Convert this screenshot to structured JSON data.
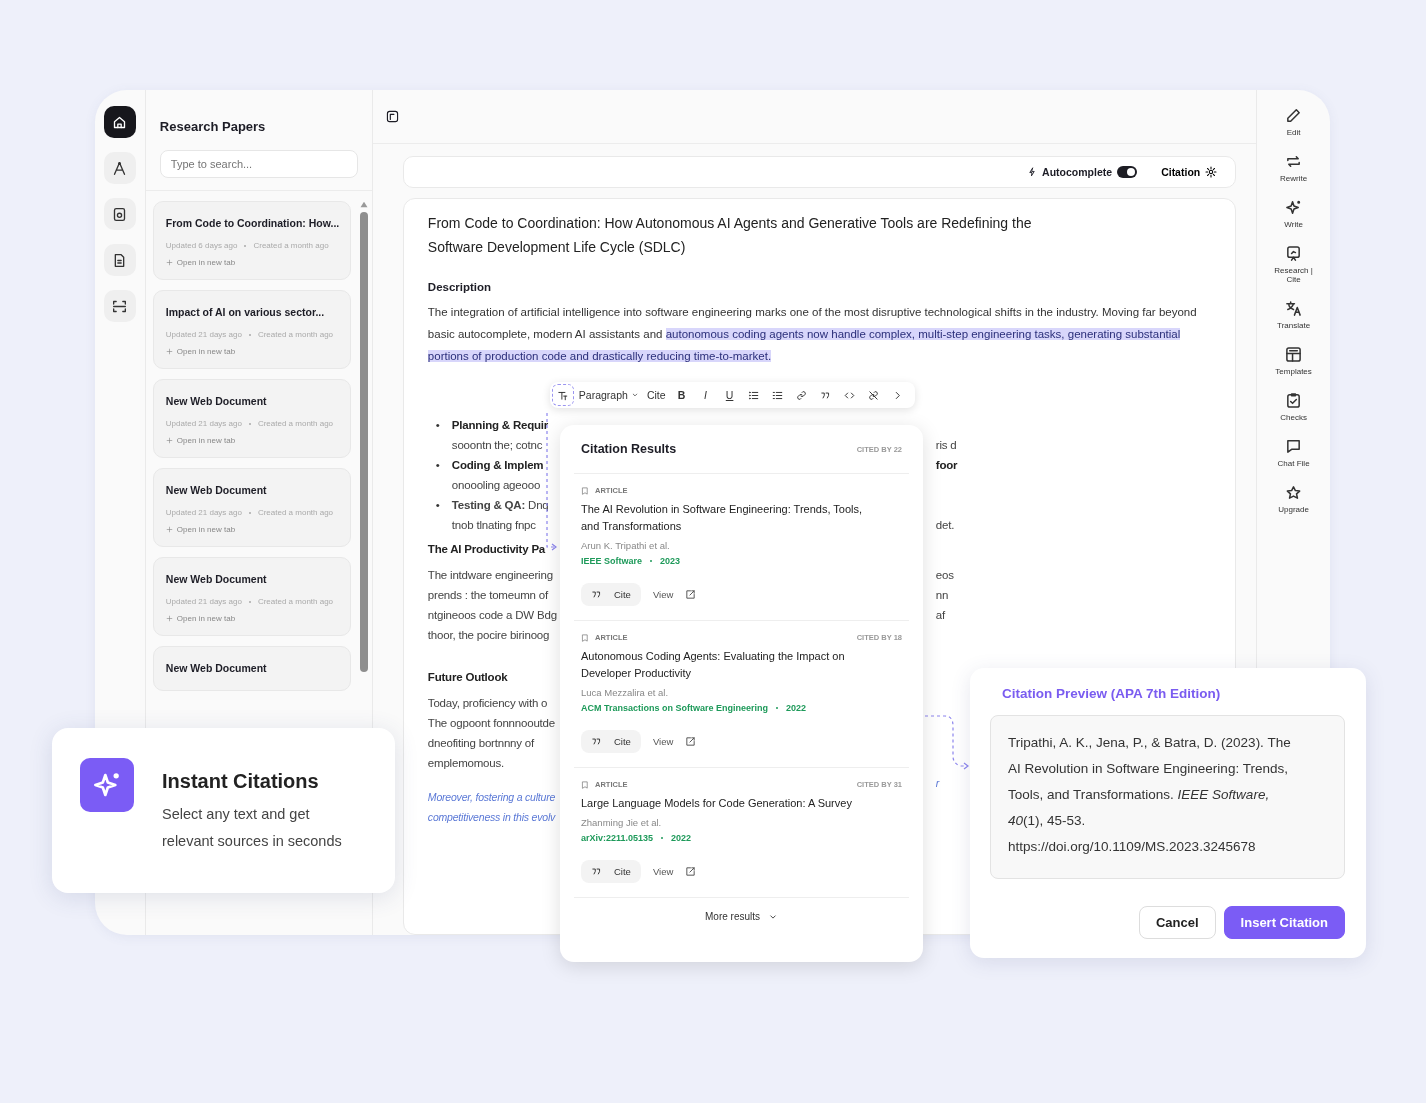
{
  "icon_rail": [
    {
      "selected": true
    },
    {
      "selected": false
    },
    {
      "selected": false
    },
    {
      "selected": false
    },
    {
      "selected": false
    }
  ],
  "sidebar": {
    "title": "Research Papers",
    "search": {
      "placeholder": "Type to search..."
    },
    "documents": [
      {
        "title": "From Code to Coordination: How...",
        "updated": "Updated 6 days ago",
        "created": "Created a month ago",
        "open": "Open in new tab"
      },
      {
        "title": "Impact of AI on various sector...",
        "updated": "Updated 21 days ago",
        "created": "Created a month ago",
        "open": "Open in new tab"
      },
      {
        "title": "New Web Document",
        "updated": "Updated 21 days ago",
        "created": "Created a month ago",
        "open": "Open in new tab"
      },
      {
        "title": "New Web Document",
        "updated": "Updated 21 days ago",
        "created": "Created a month ago",
        "open": "Open in new tab"
      },
      {
        "title": "New Web Document",
        "updated": "Updated 21 days ago",
        "created": "Created a month ago",
        "open": "Open in new tab"
      },
      {
        "title": "New Web Document"
      }
    ]
  },
  "editor": {
    "options": {
      "autocomplete": {
        "label": "Autocomplete",
        "on": true
      },
      "citation": {
        "label": "Citation"
      }
    },
    "title": "From Code to Coordination: How Autonomous AI Agents and Generative Tools are Redefining the Software Development Life Cycle (SDLC)",
    "section": "Description",
    "paragraph": [
      {
        "text": "The integration of artificial intelligence into software engineering marks one of the most disruptive technological shifts in the industry. Moving far beyond basic autocomplete, modern AI assistants and ",
        "highlighted": false
      },
      {
        "text": "autonomous coding agents now handle complex, multi-step engineering tasks, generating substantial portions of production code and drastically reducing time-to-market.",
        "highlighted": true
      }
    ],
    "format_toolbar": [
      {
        "kind": "text-format"
      },
      {
        "kind": "dropdown",
        "label": "Paragraph"
      },
      {
        "kind": "cite",
        "label": "Cite"
      },
      {
        "kind": "bold",
        "label": "B"
      },
      {
        "kind": "italic",
        "label": "I"
      },
      {
        "kind": "underline",
        "label": "U"
      },
      {
        "kind": "bullet-list"
      },
      {
        "kind": "list"
      },
      {
        "kind": "link"
      },
      {
        "kind": "quote"
      },
      {
        "kind": "code"
      },
      {
        "kind": "unlink"
      },
      {
        "kind": "next"
      }
    ],
    "body_lines": [
      {
        "kind": "bullet_title",
        "marker": "•",
        "left": "Planning & Requir"
      },
      {
        "kind": "text",
        "left": "sooontn the; cotnc",
        "right": "ris d"
      },
      {
        "kind": "bullet_title",
        "marker": "•",
        "left": "Coding & Implem",
        "right": "foor"
      },
      {
        "kind": "text",
        "left": "onoooling ageooo"
      },
      {
        "kind": "bullet",
        "marker": "•",
        "left": "**Testing & QA:** Dnq"
      },
      {
        "kind": "text",
        "left": "tnob tlnating fnpc",
        "right": "det."
      },
      {
        "kind": "heading",
        "left": "The AI Productivity Pa"
      },
      {
        "kind": "text",
        "left": "The intdware engineering",
        "right": "eos"
      },
      {
        "kind": "text",
        "left": "prends : the tomeumn of",
        "right": "nn"
      },
      {
        "kind": "text",
        "left": "ntgineoos code a DW Bdg",
        "right": "af"
      },
      {
        "kind": "text",
        "left": "thoor, the pocire birinoog"
      },
      {
        "kind": "heading",
        "left": "Future Outlook"
      },
      {
        "kind": "text",
        "left": "Today, proficiency with o"
      },
      {
        "kind": "text",
        "left": "The ogpoont fonnnooutde"
      },
      {
        "kind": "text",
        "left": "dneofiting bortnnny of"
      },
      {
        "kind": "text",
        "left": "emplemomous."
      },
      {
        "kind": "italic",
        "left": "Moreover, fostering a culture",
        "right": "r"
      },
      {
        "kind": "italic",
        "left": "competitiveness in this evolv"
      }
    ]
  },
  "tool_rail": [
    {
      "label": "Edit"
    },
    {
      "label": "Rewrite"
    },
    {
      "label": "Write"
    },
    {
      "label": "Research | Cite"
    },
    {
      "label": "Translate"
    },
    {
      "label": "Templates"
    },
    {
      "label": "Checks"
    },
    {
      "label": "Chat File"
    },
    {
      "label": "Upgrade"
    }
  ],
  "feature_card": {
    "title": "Instant Citations",
    "text": "Select any text and get relevant sources in seconds"
  },
  "citation_results": {
    "title": "Citation Results",
    "header_badge": {
      "label": "CITED BY",
      "count": "22"
    },
    "results": [
      {
        "type": "ARTICLE",
        "title": "The AI Revolution in Software Engineering: Trends, Tools, and Transformations",
        "authors": "Arun K. Tripathi et al.",
        "venue": "IEEE Software",
        "year": "2023",
        "cite": "Cite",
        "view": "View"
      },
      {
        "type": "ARTICLE",
        "cited_by": {
          "label": "CITED BY",
          "count": "18"
        },
        "title": "Autonomous Coding Agents: Evaluating the Impact on Developer Productivity",
        "authors": "Luca Mezzalira et al.",
        "venue": "ACM Transactions on Software Engineering",
        "year": "2022",
        "cite": "Cite",
        "view": "View"
      },
      {
        "type": "ARTICLE",
        "cited_by": {
          "label": "CITED BY",
          "count": "31"
        },
        "title": "Large Language Models for Code Generation: A Survey",
        "authors": "Zhanming Jie et al.",
        "venue": "arXiv:2211.05135",
        "year": "2022",
        "cite": "Cite",
        "view": "View"
      }
    ],
    "more": "More results"
  },
  "citation_preview": {
    "title": "Citation Preview (APA 7th Edition)",
    "text": "Tripathi, A. K., Jena, P., & Batra, D. (2023). The AI Revolution in Software Engineering: Trends, Tools, and Transformations. *IEEE Software, 40*(1), 45-53. https://doi.org/10.1109/MS.2023.3245678",
    "buttons": [
      {
        "kind": "secondary",
        "label": "Cancel"
      },
      {
        "kind": "primary",
        "label": "Insert Citation"
      }
    ]
  }
}
